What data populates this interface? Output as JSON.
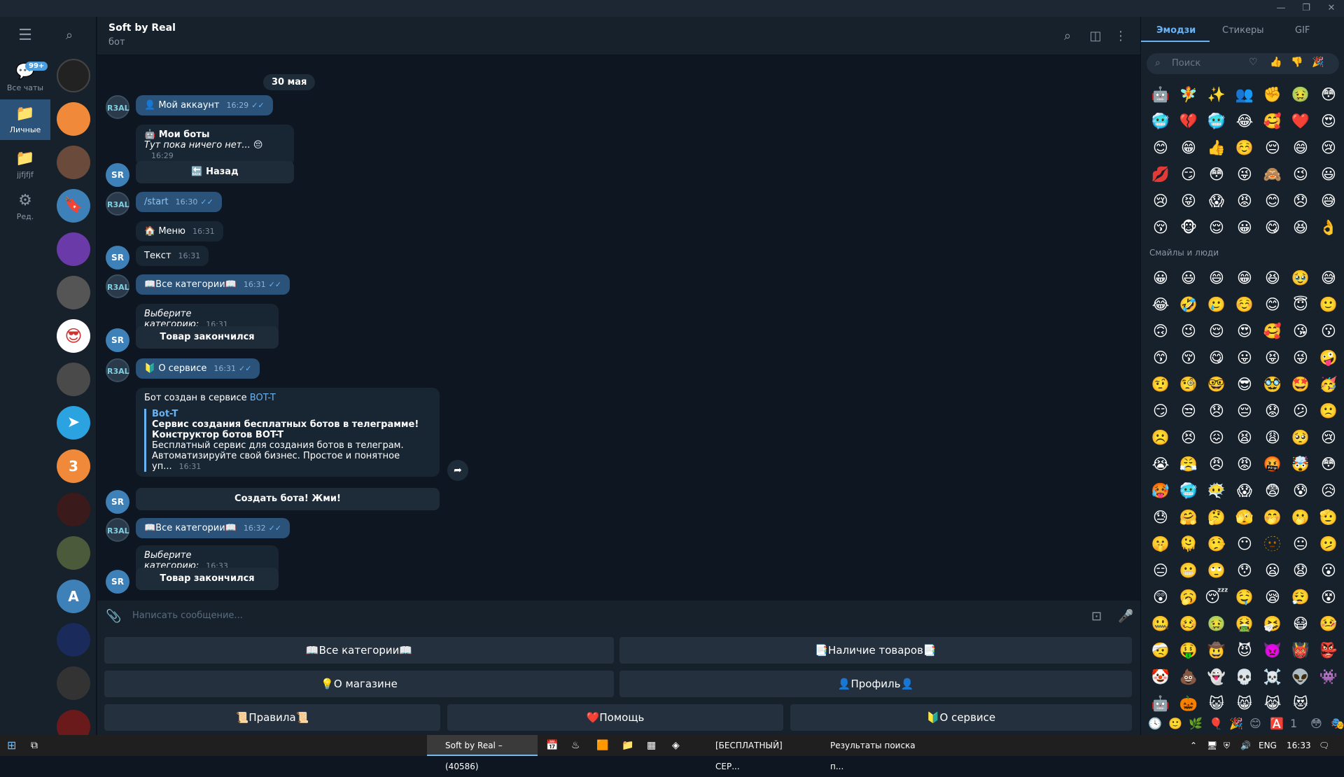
{
  "header": {
    "title": "Soft by Real",
    "subtitle": "бот"
  },
  "rail": {
    "all_chats": "Все чаты",
    "all_chats_badge": "99+",
    "personal": "Личные",
    "folder": "jjfjfjf",
    "edit": "Ред."
  },
  "chatlist": {
    "avatar_3": "3",
    "avatar_a": "A"
  },
  "messages": {
    "date": "30 мая",
    "m1_text": "👤 Мой аккаунт",
    "m1_time": "16:29",
    "m2_title": "🤖 Мои боты",
    "m2_body": "Тут пока ничего нет... 😔",
    "m2_time": "16:29",
    "m2_btn": "🔙 Назад",
    "m3_text": "/start",
    "m3_time": "16:30",
    "m4_text": "🏠 Меню",
    "m4_time": "16:31",
    "m5_text": "Текст",
    "m5_time": "16:31",
    "m6_text": "📖Все категории📖",
    "m6_time": "16:31",
    "m7_text": "Выберите категорию:",
    "m7_time": "16:31",
    "m7_btn": "Товар закончился",
    "m8_text": "🔰 О сервисе",
    "m8_time": "16:31",
    "m9_intro": "Бот создан в сервисе ",
    "m9_link": "BOT-T",
    "m9_preview_title": "Bot-T",
    "m9_preview_line1": "Сервис создания бесплатных ботов в телеграмме!",
    "m9_preview_line2": "Конструктор ботов BOT-T",
    "m9_preview_line3": "Бесплатный сервис для создания ботов в телеграм.",
    "m9_preview_line4": "Автоматизируйте свой бизнес. Простое и понятное уп...",
    "m9_time": "16:31",
    "m9_btn": "Создать бота! Жми!",
    "m10_text": "📖Все категории📖",
    "m10_time": "16:32",
    "m11_text": "Выберите категорию:",
    "m11_time": "16:33",
    "m11_btn": "Товар закончился",
    "avatar_real": "R3AL",
    "avatar_sr": "SR"
  },
  "composer": {
    "placeholder": "Написать сообщение..."
  },
  "keyboard": {
    "b1": "📖Все категории📖",
    "b2": "📑Наличие товаров📑",
    "b3": "💡О магазине",
    "b4": "👤Профиль👤",
    "b5": "📜Правила📜",
    "b6": "❤️Помощь",
    "b7": "🔰О сервисе"
  },
  "emoji_panel": {
    "tabs": [
      "Эмодзи",
      "Стикеры",
      "GIF"
    ],
    "search_placeholder": "Поиск",
    "recent": [
      "🤖",
      "🧚",
      "✨",
      "👥",
      "✊",
      "🤢",
      "😳",
      "🥶",
      "💔",
      "🥶",
      "😂",
      "🥰",
      "❤️",
      "😍",
      "😊",
      "😁",
      "👍",
      "☺️",
      "😔",
      "😄",
      "😢",
      "💋",
      "😏",
      "😳",
      "😜",
      "🙈",
      "😉",
      "😃",
      "😢",
      "😝",
      "😱",
      "😡",
      "😊",
      "😞",
      "😅",
      "😚",
      "🐵",
      "😌",
      "😀",
      "😋",
      "😆",
      "👌"
    ],
    "section_title": "Смайлы и люди",
    "smileys": [
      "😀",
      "😃",
      "😄",
      "😁",
      "😆",
      "🥹",
      "😅",
      "😂",
      "🤣",
      "🥲",
      "☺️",
      "😊",
      "😇",
      "🙂",
      "🙃",
      "😉",
      "😌",
      "😍",
      "🥰",
      "😘",
      "😗",
      "😙",
      "😚",
      "😋",
      "😛",
      "😝",
      "😜",
      "🤪",
      "🤨",
      "🧐",
      "🤓",
      "😎",
      "🥸",
      "🤩",
      "🥳",
      "😏",
      "😒",
      "😞",
      "😔",
      "😟",
      "😕",
      "🙁",
      "☹️",
      "😣",
      "😖",
      "😫",
      "😩",
      "🥺",
      "😢",
      "😭",
      "😤",
      "😠",
      "😡",
      "🤬",
      "🤯",
      "😳",
      "🥵",
      "🥶",
      "😶‍🌫️",
      "😱",
      "😨",
      "😰",
      "😥",
      "😓",
      "🤗",
      "🤔",
      "🫣",
      "🤭",
      "🫢",
      "🫡",
      "🤫",
      "🫠",
      "🤥",
      "😶",
      "🫥",
      "😐",
      "🫤",
      "😑",
      "😬",
      "🙄",
      "😯",
      "😦",
      "😧",
      "😮",
      "😲",
      "🥱",
      "😴",
      "🤤",
      "😪",
      "😮‍💨",
      "😵",
      "🤐",
      "🥴",
      "🤢",
      "🤮",
      "🤧",
      "😷",
      "🤒",
      "🤕",
      "🤑",
      "🤠",
      "😈",
      "👿",
      "👹",
      "👺",
      "🤡",
      "💩",
      "👻",
      "💀",
      "☠️",
      "👽",
      "👾",
      "🤖",
      "🎃",
      "😺",
      "😸",
      "😹",
      "😻"
    ],
    "bottom_icons": [
      "🕓",
      "🙂",
      "🌿",
      "🎈",
      "🎉",
      "😊",
      "🅰️",
      "1",
      "😳",
      "🎭"
    ]
  },
  "taskbar": {
    "apps": [
      "Soft by Real – (40586)",
      "[БЕСПЛАТНЫЙ] СЕР...",
      "Результаты поиска п..."
    ],
    "lang": "ENG",
    "time": "16:33"
  }
}
